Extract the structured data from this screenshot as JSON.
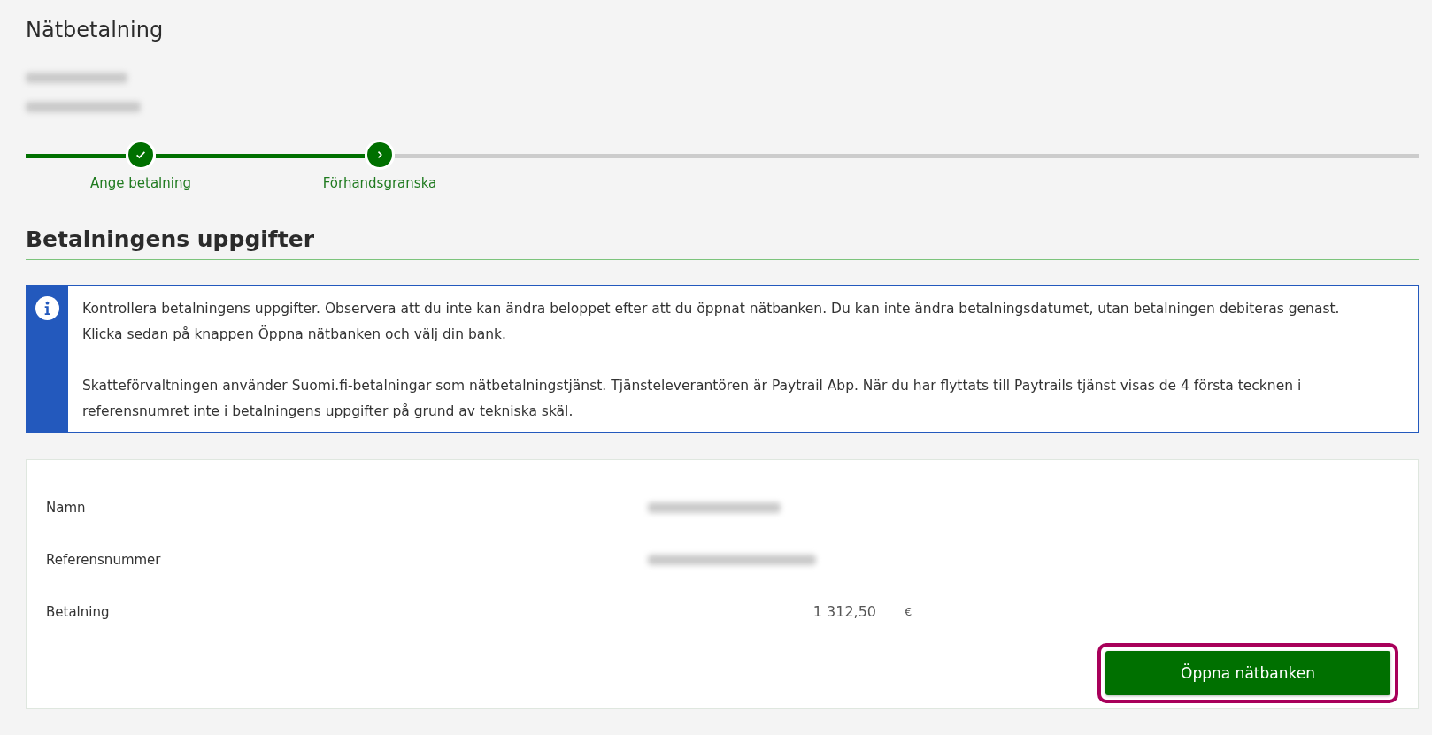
{
  "page": {
    "title": "Nätbetalning",
    "header_lines": [
      {
        "kind": "redacted"
      },
      {
        "kind": "redacted"
      }
    ]
  },
  "steps": [
    {
      "label": "Ange betalning",
      "done": true,
      "selected": false
    },
    {
      "label": "Förhandsgranska",
      "done": false,
      "selected": true
    }
  ],
  "section": {
    "heading": "Betalningens uppgifter"
  },
  "info": {
    "paragraphs": [
      "Kontrollera betalningens uppgifter. Observera att du inte kan ändra beloppet efter att du öppnat nätbanken. Du kan inte ändra betalningsdatumet, utan betalningen debiteras genast. Klicka sedan på knappen Öppna nätbanken och välj din bank.",
      "Skatteförvaltningen använder Suomi.fi-betalningar som nätbetalningstjänst. Tjänsteleverantören är Paytrail Abp. När du har flyttats till Paytrails tjänst visas de 4 första tecknen i referensnumret inte i betalningens uppgifter på grund av tekniska skäl."
    ]
  },
  "details": [
    {
      "label": "Namn",
      "kind": "redacted"
    },
    {
      "label": "Referensnummer",
      "kind": "redacted"
    },
    {
      "label": "Betalning",
      "kind": "amount",
      "value": "1 312,50",
      "unit": "€"
    }
  ],
  "button": {
    "label": "Öppna nätbanken",
    "highlighted": true
  }
}
